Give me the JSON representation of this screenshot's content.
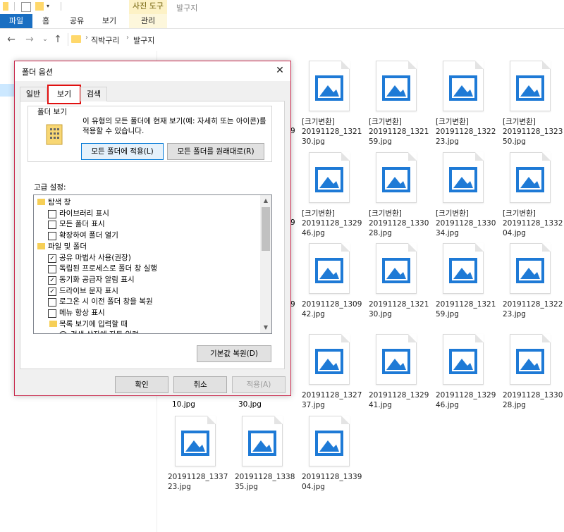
{
  "ribbon": {
    "tabs": [
      "파일",
      "홈",
      "공유",
      "보기",
      "관리"
    ],
    "context_header": "사진 도구",
    "context_title": "발구지"
  },
  "address": {
    "crumbs": [
      "직박구리",
      "발구지"
    ],
    "separator": "›",
    "back": "←",
    "forward": "→",
    "history": "⌄",
    "up": "↑"
  },
  "files": [
    {
      "name": "[크기변환]\n20191128_1321\n30.jpg"
    },
    {
      "name": "[크기변환]\n20191128_1321\n59.jpg"
    },
    {
      "name": "[크기변환]\n20191128_1322\n23.jpg"
    },
    {
      "name": "[크기변환]\n20191128_1323\n50.jpg"
    },
    {
      "name": "[크기변환]\n20191128_1329\n46.jpg"
    },
    {
      "name": "[크기변환]\n20191128_1330\n28.jpg"
    },
    {
      "name": "[크기변환]\n20191128_1330\n34.jpg"
    },
    {
      "name": "[크기변환]\n20191128_1332\n04.jpg"
    },
    {
      "name": "20191128_1309\n42.jpg"
    },
    {
      "name": "20191128_1321\n30.jpg"
    },
    {
      "name": "20191128_1321\n59.jpg"
    },
    {
      "name": "20191128_1322\n23.jpg"
    },
    {
      "name": "20191128_1327\n37.jpg"
    },
    {
      "name": "20191128_1329\n41.jpg"
    },
    {
      "name": "20191128_1329\n46.jpg"
    },
    {
      "name": "20191128_1330\n28.jpg"
    },
    {
      "name": "20191128_1337\n23.jpg"
    },
    {
      "name": "20191128_1338\n35.jpg"
    },
    {
      "name": "20191128_1339\n04.jpg"
    }
  ],
  "partial_names": {
    "r1": "9",
    "r2": "9",
    "r3": "9",
    "r4c1": "10.jpg",
    "r4c2": "30.jpg"
  },
  "dialog": {
    "title": "폴더 옵션",
    "close": "✕",
    "tabs": [
      "일반",
      "보기",
      "검색"
    ],
    "active_tab": "보기",
    "folder_view": {
      "label": "폴더 보기",
      "description": "이 유형의 모든 폴더에 현재 보기(예: 자세히 또는 아이콘)를 적용할 수 있습니다.",
      "apply_button": "모든 폴더에 적용(L)",
      "reset_button": "모든 폴더를 원래대로(R)"
    },
    "advanced_label": "고급 설정:",
    "settings": [
      {
        "type": "group",
        "label": "탐색 창"
      },
      {
        "type": "check",
        "label": "라이브러리 표시",
        "checked": false
      },
      {
        "type": "check",
        "label": "모든 폴더 표시",
        "checked": false
      },
      {
        "type": "check",
        "label": "확장하여 폴더 열기",
        "checked": false
      },
      {
        "type": "group",
        "label": "파일 및 폴더"
      },
      {
        "type": "check",
        "label": "공유 마법사 사용(권장)",
        "checked": true
      },
      {
        "type": "check",
        "label": "독립된 프로세스로 폴더 창 실행",
        "checked": false
      },
      {
        "type": "check",
        "label": "동기화 공급자 알림 표시",
        "checked": true
      },
      {
        "type": "check",
        "label": "드라이브 문자 표시",
        "checked": true
      },
      {
        "type": "check",
        "label": "로그온 시 이전 폴더 창을 복원",
        "checked": false
      },
      {
        "type": "check",
        "label": "메뉴 항상 표시",
        "checked": false
      },
      {
        "type": "subgroup",
        "label": "목록 보기에 입력할 때"
      },
      {
        "type": "radio",
        "label": "검색 상자에 자동 입력",
        "checked": true
      }
    ],
    "restore_defaults": "기본값 복원(D)",
    "ok": "확인",
    "cancel": "취소",
    "apply": "적용(A)"
  },
  "colors": {
    "accent": "#1a6fc2",
    "dialog_border": "#c8274b",
    "tab_highlight": "#e01010",
    "image_icon": "#1e7ad6"
  }
}
